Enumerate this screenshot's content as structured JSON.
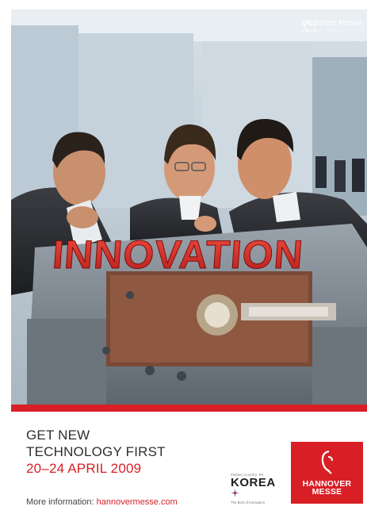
{
  "brand": {
    "organizer_name": "Deutsche Messe",
    "organizer_sub": "Hannover · Germany",
    "fair_logo_line1": "HANNOVER",
    "fair_logo_line2": "MESSE"
  },
  "image": {
    "headline_word": "INNOVATION"
  },
  "headline": {
    "line1": "GET NEW",
    "line2": "TECHNOLOGY FIRST",
    "dates": "20–24 APRIL 2009"
  },
  "footer": {
    "more_label": "More information:",
    "url": "hannovermesse.com"
  },
  "partner": {
    "label": "Partner Country '09",
    "name": "KOREA",
    "tagline": "The Best of Innovation"
  },
  "colors": {
    "accent_red": "#d81f26",
    "text_dark": "#2f2f2f"
  }
}
